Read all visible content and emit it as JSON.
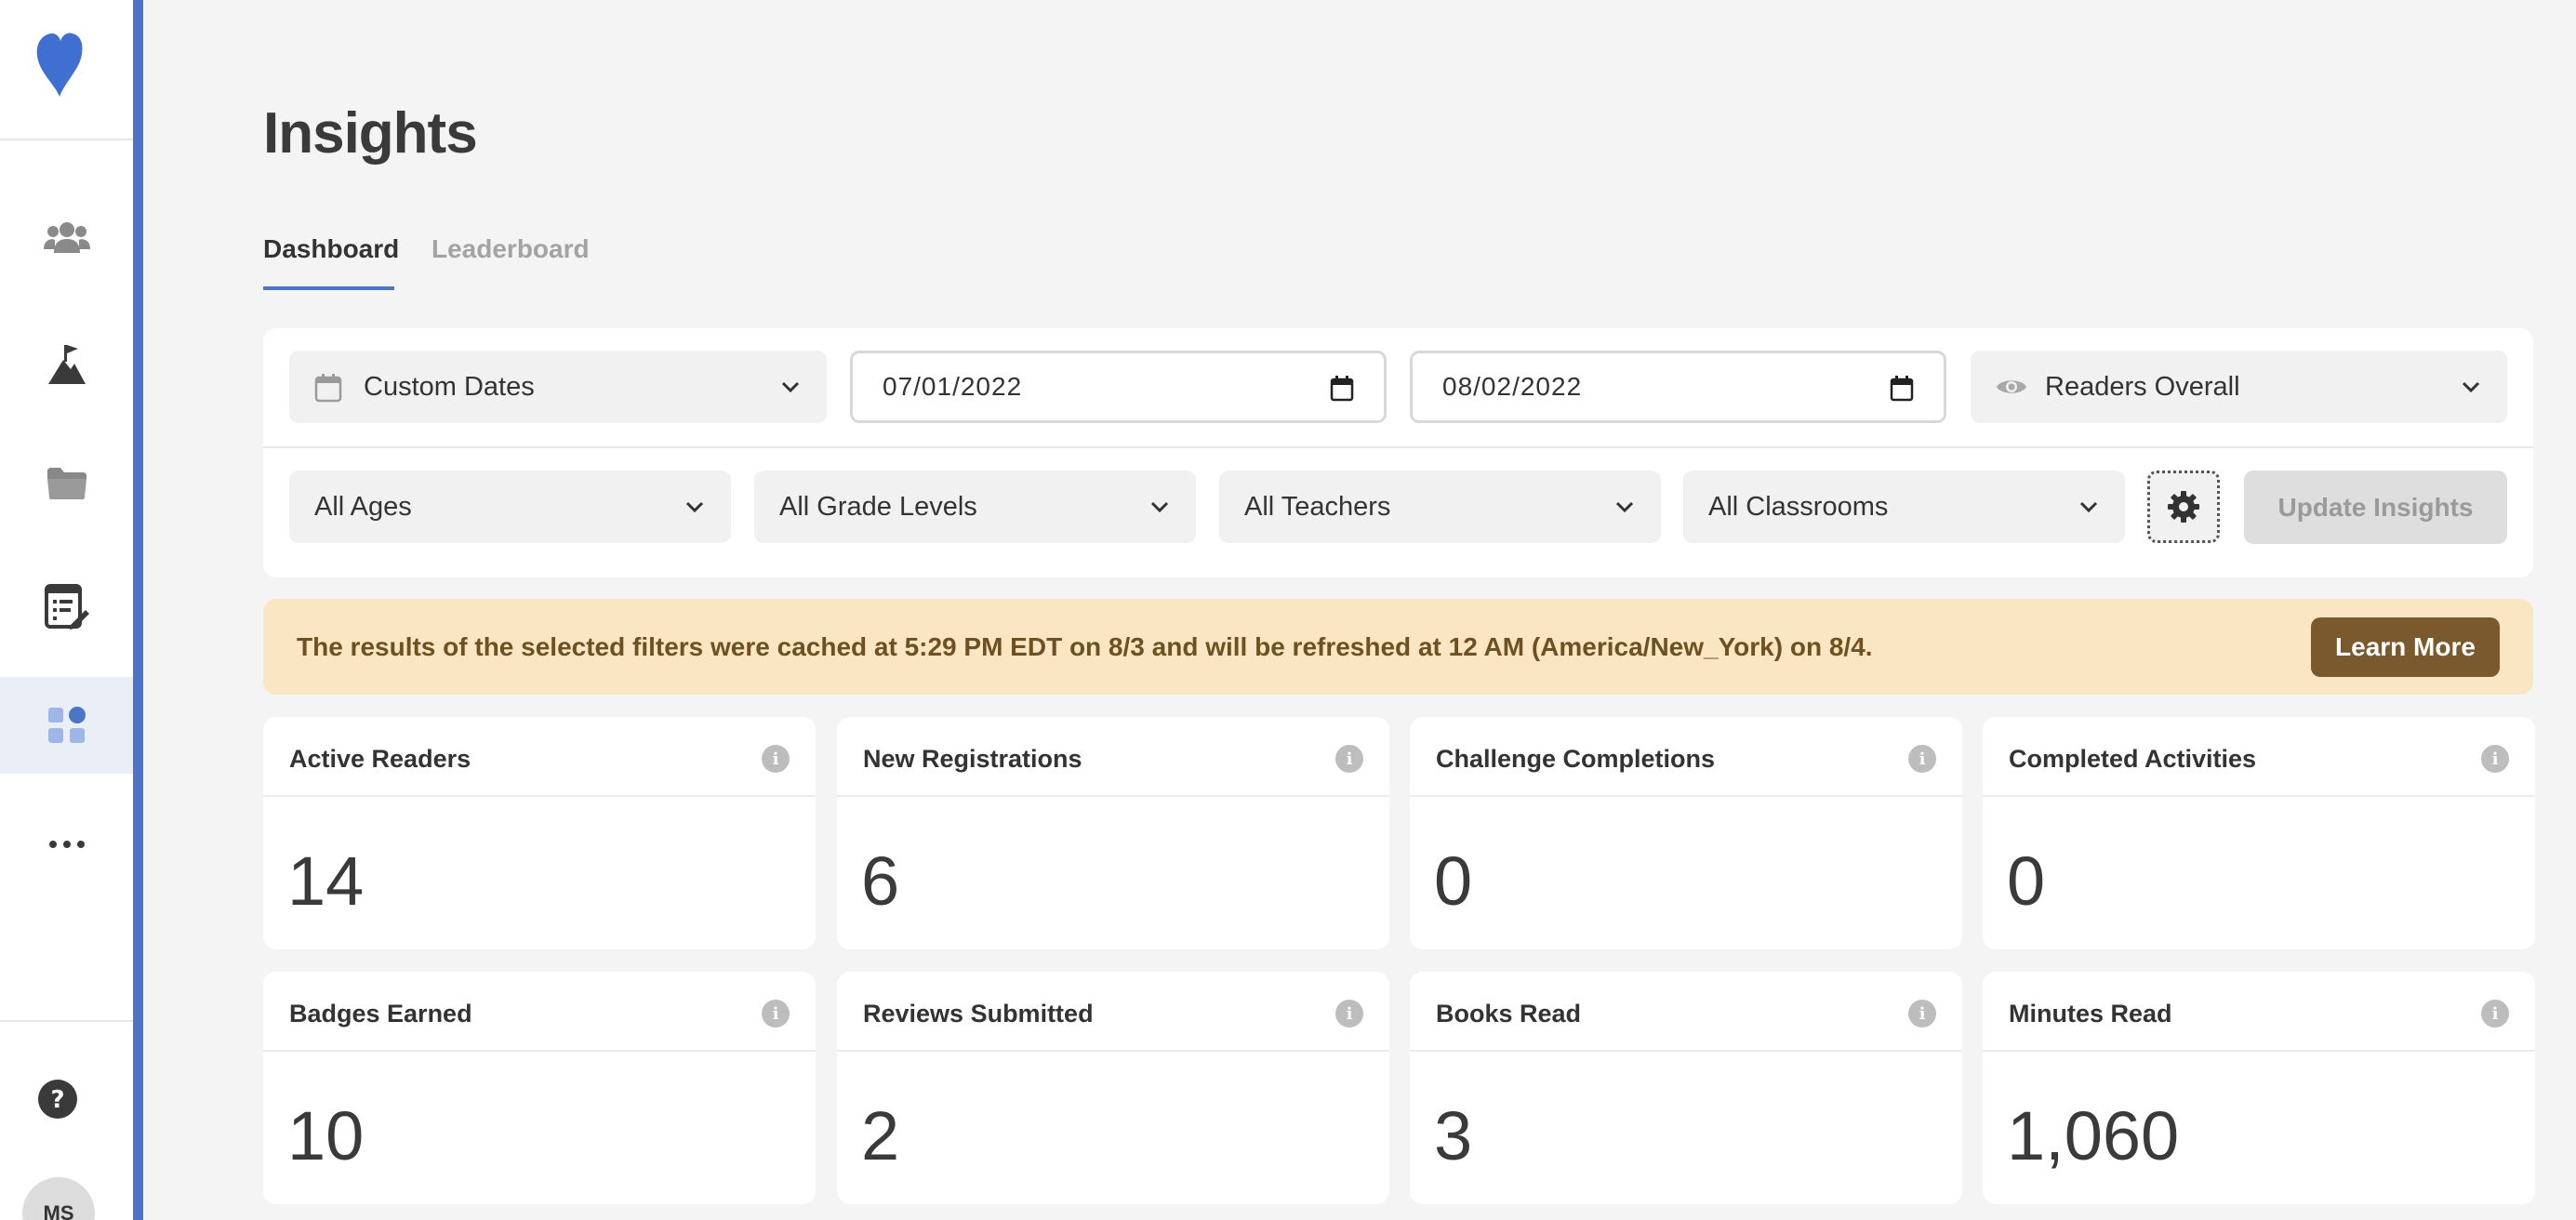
{
  "sidebar": {
    "logo": "heart-logo",
    "items": [
      {
        "name": "people",
        "icon": "people-icon"
      },
      {
        "name": "challenges",
        "icon": "mountain-flag-icon"
      },
      {
        "name": "resources",
        "icon": "folder-icon"
      },
      {
        "name": "activities",
        "icon": "checklist-edit-icon"
      },
      {
        "name": "insights",
        "icon": "dashboard-icon",
        "active": true
      },
      {
        "name": "more",
        "icon": "more-dots-icon"
      }
    ],
    "help_icon": "help-icon",
    "avatar_initials": "MS"
  },
  "header": {
    "title": "Insights",
    "tabs": [
      {
        "label": "Dashboard",
        "active": true
      },
      {
        "label": "Leaderboard",
        "active": false
      }
    ]
  },
  "filters": {
    "date_range": "Custom Dates",
    "start_date": "07/01/2022",
    "end_date": "08/02/2022",
    "view": "Readers Overall",
    "ages": "All Ages",
    "grade_levels": "All Grade Levels",
    "teachers": "All Teachers",
    "classrooms": "All Classrooms",
    "update_label": "Update Insights"
  },
  "notice": {
    "text": "The results of the selected filters were cached at 5:29 PM EDT on 8/3 and will be refreshed at 12 AM (America/New_York) on 8/4.",
    "button_label": "Learn More"
  },
  "stats": [
    {
      "title": "Active Readers",
      "value": "14"
    },
    {
      "title": "New Registrations",
      "value": "6"
    },
    {
      "title": "Challenge Completions",
      "value": "0"
    },
    {
      "title": "Completed Activities",
      "value": "0"
    },
    {
      "title": "Badges Earned",
      "value": "10"
    },
    {
      "title": "Reviews Submitted",
      "value": "2"
    },
    {
      "title": "Books Read",
      "value": "3"
    },
    {
      "title": "Minutes Read",
      "value": "1,060"
    }
  ],
  "info_glyph": "i",
  "colors": {
    "accent": "#4a75c9",
    "notice_bg": "#fbe6c3",
    "notice_text": "#6e5123",
    "learn_more_bg": "#7a5a2c"
  }
}
